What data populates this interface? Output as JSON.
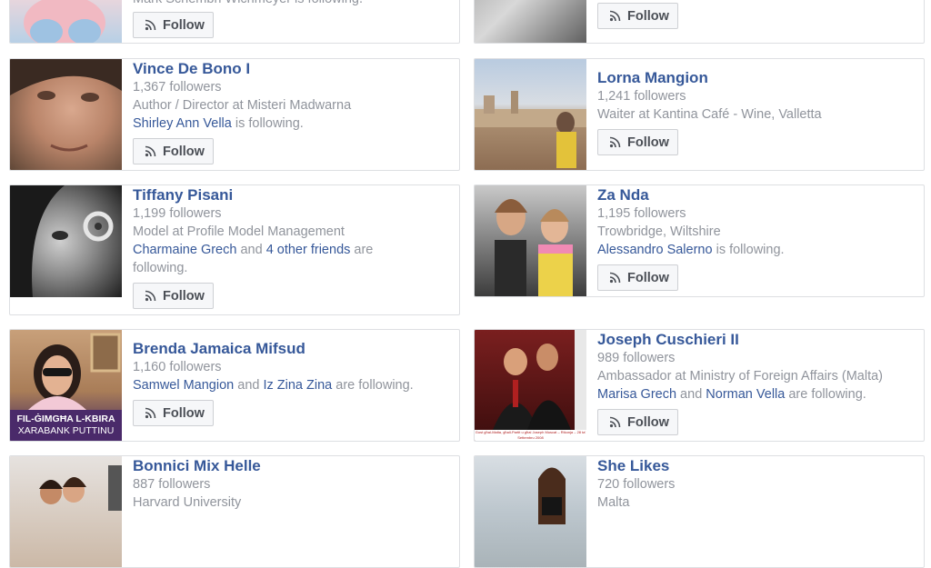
{
  "follow_label": "Follow",
  "top_left_cut_text": "Mark Schembri Wichmeyer is following.",
  "cards": [
    {
      "name": "Vince De Bono I",
      "followers": "1,367 followers",
      "detail_plain": "Author / Director at Misteri Madwarna",
      "friends_link": "Shirley Ann Vella",
      "friends_tail": " is following."
    },
    {
      "name": "Lorna Mangion",
      "followers": "1,241 followers",
      "detail_plain": "Waiter at Kantina Café - Wine, Valletta"
    },
    {
      "name": "Tiffany Pisani",
      "followers": "1,199 followers",
      "detail_plain": "Model at Profile Model Management",
      "friends_link": "Charmaine Grech",
      "friends_mid": " and ",
      "friends_link2": "4 other friends",
      "friends_tail": " are following."
    },
    {
      "name": "Za Nda",
      "followers": "1,195 followers",
      "detail_plain": "Trowbridge, Wiltshire",
      "friends_link": "Alessandro Salerno",
      "friends_tail": " is following."
    },
    {
      "name": "Brenda Jamaica Mifsud",
      "followers": "1,160 followers",
      "friends_link": "Samwel Mangion",
      "friends_mid": " and ",
      "friends_link2": "Iz Zina Zina",
      "friends_tail": " are following.",
      "photo_caption_1": "FIL-ĠIMGĦA L-KBIRA",
      "photo_caption_2": "XARABANK PUTTINU"
    },
    {
      "name": "Joseph Cuschieri II",
      "followers": "989 followers",
      "detail_plain": "Ambassador at Ministry of Foreign Affairs (Malta)",
      "friends_link": "Marisa Grech",
      "friends_mid": " and ",
      "friends_link2": "Norman Vella",
      "friends_tail": " are following.",
      "photo_caption": "Gost għal-Malta, għall-Partit u għal Joseph Muscat – Rikonja – 28 ta' Settembru 2008"
    },
    {
      "name": "Bonnici Mix Helle",
      "followers": "887 followers",
      "detail_plain": "Harvard University"
    },
    {
      "name": "She Likes",
      "followers": "720 followers",
      "detail_plain": "Malta"
    }
  ],
  "colors": {
    "link": "#365899",
    "muted": "#90949c",
    "border": "#dddfe2",
    "button_bg": "#f6f7f9"
  }
}
